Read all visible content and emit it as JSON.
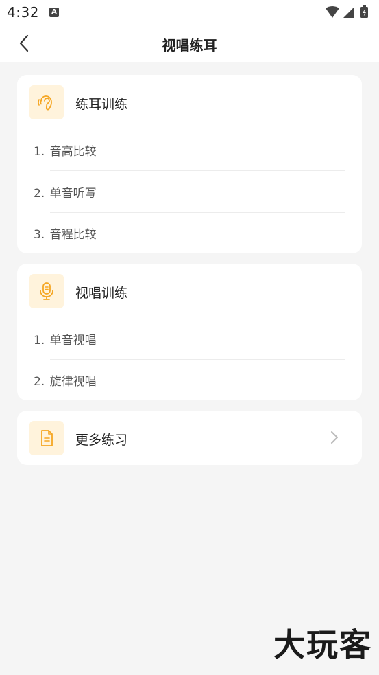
{
  "status_bar": {
    "time": "4:32",
    "notification_icon": "app-notification-icon",
    "icons": [
      "wifi-icon",
      "signal-icon",
      "battery-charging-icon"
    ]
  },
  "nav": {
    "title": "视唱练耳",
    "back_icon": "chevron-left-icon"
  },
  "sections": [
    {
      "title": "练耳训练",
      "icon": "ear-icon",
      "items": [
        {
          "num": "1.",
          "label": "音高比较"
        },
        {
          "num": "2.",
          "label": "单音听写"
        },
        {
          "num": "3.",
          "label": "音程比较"
        }
      ]
    },
    {
      "title": "视唱训练",
      "icon": "microphone-icon",
      "items": [
        {
          "num": "1.",
          "label": "单音视唱"
        },
        {
          "num": "2.",
          "label": "旋律视唱"
        }
      ]
    }
  ],
  "more": {
    "title": "更多练习",
    "icon": "document-icon",
    "arrow_icon": "chevron-right-icon"
  },
  "watermark": "大玩客",
  "colors": {
    "accent": "#f5a623",
    "icon_bg": "#fff3dc",
    "background": "#f5f5f5",
    "card": "#ffffff"
  }
}
